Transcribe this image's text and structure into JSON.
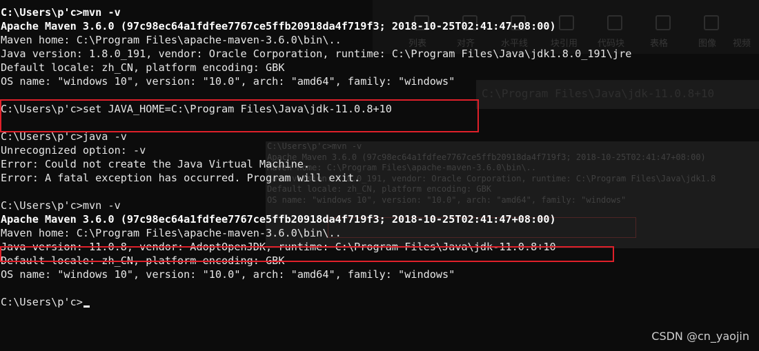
{
  "ghost": {
    "toolbar_items": [
      "列表",
      "对齐",
      "水平线",
      "块引用",
      "代码块",
      "表格",
      "图像",
      "视频"
    ],
    "band_text": "C:\\Program Files\\Java\\jdk-11.0.8+10",
    "panel_lines": [
      "C:\\Users\\p'c>mvn -v",
      "Apache Maven 3.6.0 (97c98ec64a1fdfee7767ce5ffb20918da4f719f3; 2018-10-25T02:41:47+08:00)",
      "Maven home: C:\\Program Files\\apache-maven-3.6.0\\bin\\..",
      "Java version: 1.8.0_191, vendor: Oracle Corporation, runtime: C:\\Program Files\\Java\\jdk1.8",
      "Default locale: zh_CN, platform encoding: GBK",
      "OS name: \"windows 10\", version: \"10.0\", arch: \"amd64\", family: \"windows\""
    ]
  },
  "terminal": {
    "lines": [
      "C:\\Users\\p'c>mvn -v",
      "Apache Maven 3.6.0 (97c98ec64a1fdfee7767ce5ffb20918da4f719f3; 2018-10-25T02:41:47+08:00)",
      "Maven home: C:\\Program Files\\apache-maven-3.6.0\\bin\\..",
      "Java version: 1.8.0_191, vendor: Oracle Corporation, runtime: C:\\Program Files\\Java\\jdk1.8.0_191\\jre",
      "Default locale: zh_CN, platform encoding: GBK",
      "OS name: \"windows 10\", version: \"10.0\", arch: \"amd64\", family: \"windows\"",
      "",
      "C:\\Users\\p'c>set JAVA_HOME=C:\\Program Files\\Java\\jdk-11.0.8+10",
      "",
      "C:\\Users\\p'c>java -v",
      "Unrecognized option: -v",
      "Error: Could not create the Java Virtual Machine.",
      "Error: A fatal exception has occurred. Program will exit.",
      "",
      "C:\\Users\\p'c>mvn -v",
      "Apache Maven 3.6.0 (97c98ec64a1fdfee7767ce5ffb20918da4f719f3; 2018-10-25T02:41:47+08:00)",
      "Maven home: C:\\Program Files\\apache-maven-3.6.0\\bin\\..",
      "Java version: 11.0.8, vendor: AdoptOpenJDK, runtime: C:\\Program Files\\Java\\jdk-11.0.8+10",
      "Default locale: zh_CN, platform encoding: GBK",
      "OS name: \"windows 10\", version: \"10.0\", arch: \"amd64\", family: \"windows\"",
      "",
      "C:\\Users\\p'c>"
    ]
  },
  "highlight_color": "#e0202a",
  "watermark": "CSDN @cn_yaojin"
}
